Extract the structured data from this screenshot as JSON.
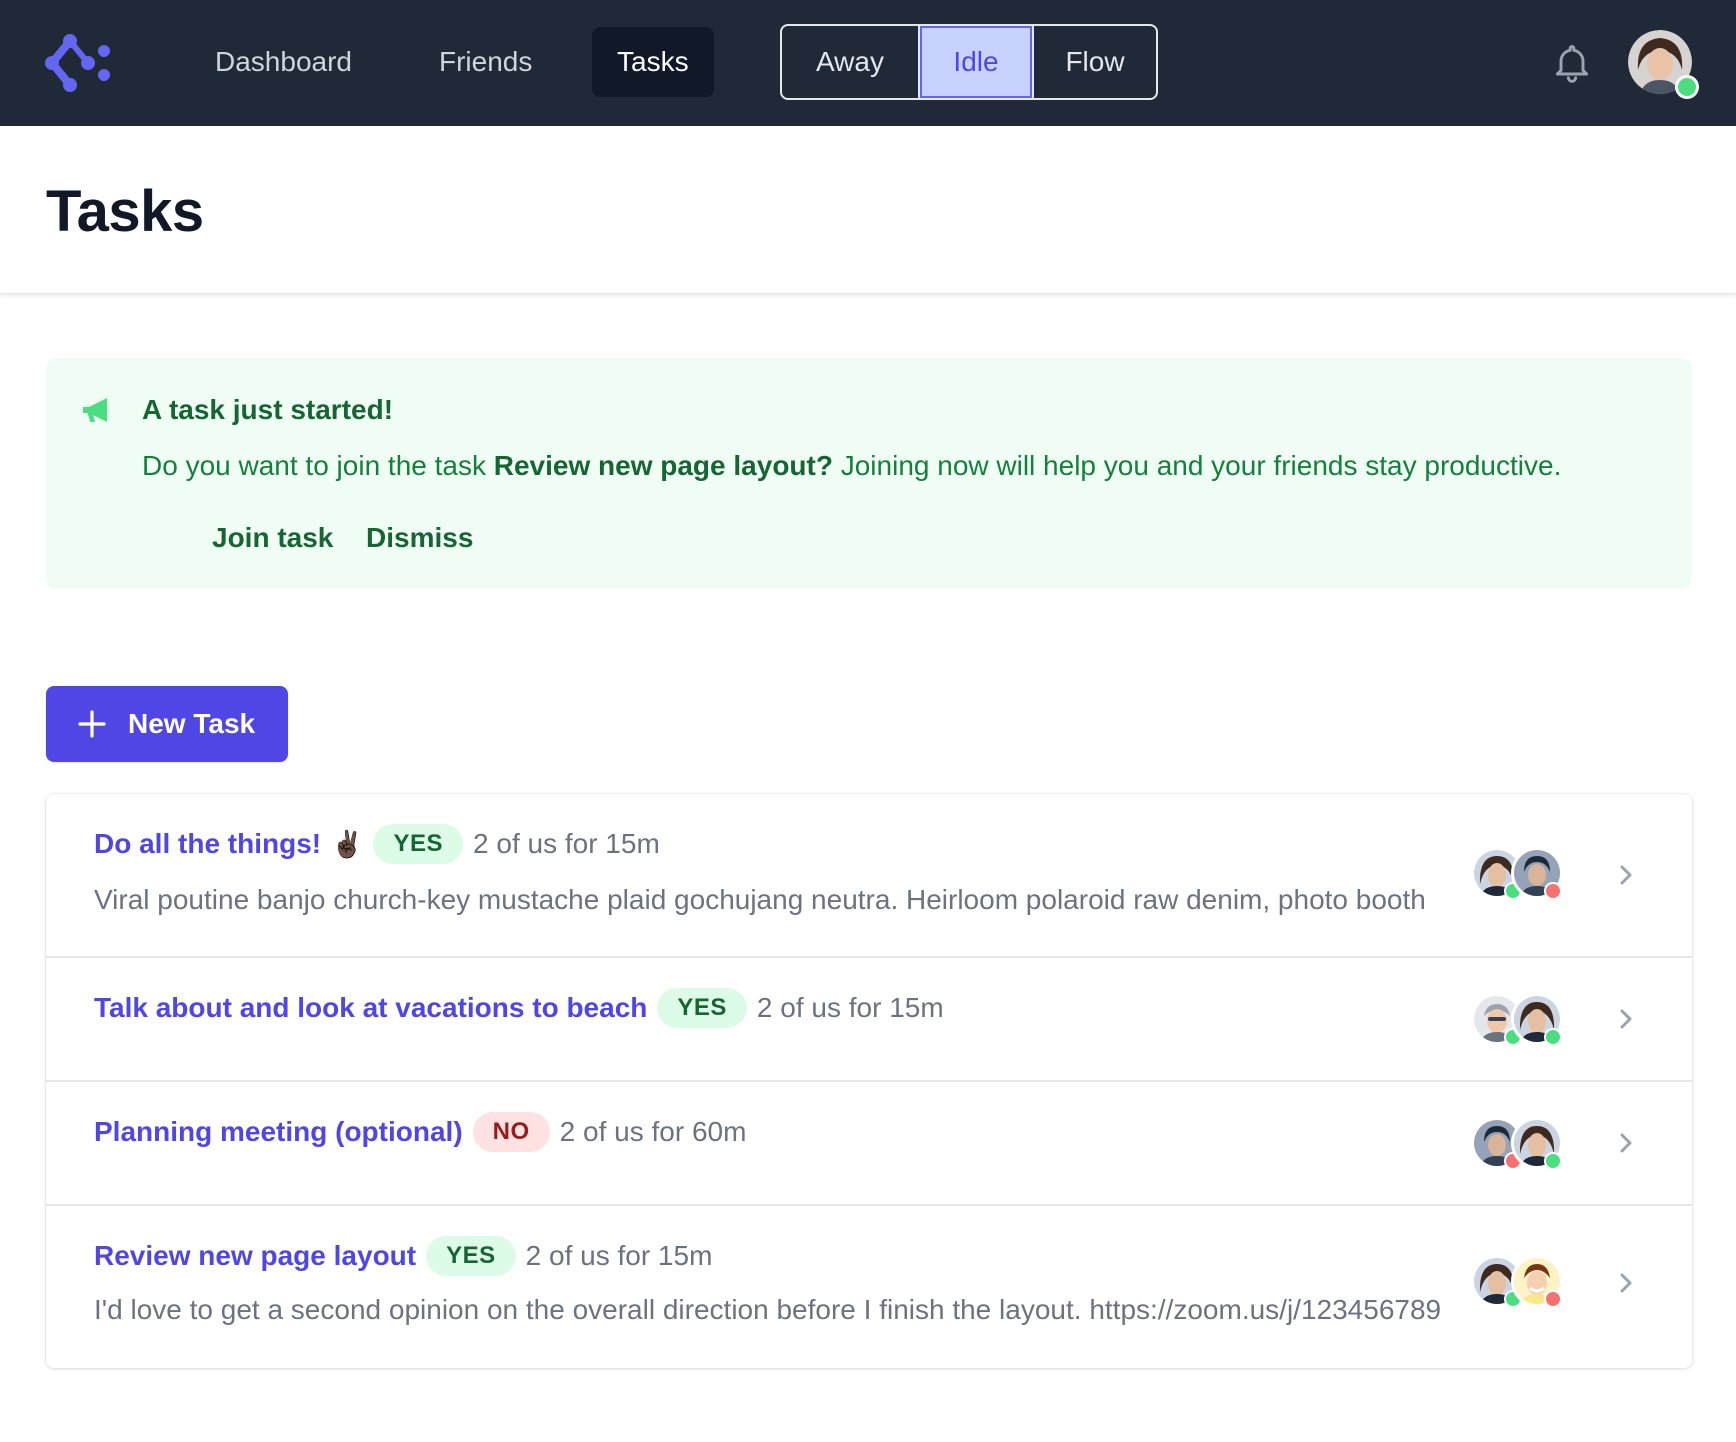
{
  "nav": {
    "links": [
      {
        "label": "Dashboard"
      },
      {
        "label": "Friends"
      },
      {
        "label": "Tasks"
      }
    ],
    "status_options": [
      {
        "label": "Away"
      },
      {
        "label": "Idle"
      },
      {
        "label": "Flow"
      }
    ],
    "selected_status": "Idle"
  },
  "page": {
    "title": "Tasks"
  },
  "alert": {
    "title": "A task just started!",
    "body_prefix": "Do you want to join the task ",
    "body_task": "Review new page layout?",
    "body_suffix": " Joining now will help you and your friends stay productive.",
    "join_label": "Join task",
    "dismiss_label": "Dismiss"
  },
  "new_task_label": "New Task",
  "tasks": [
    {
      "title": "Do all the things!",
      "emoji": "✌🏿",
      "badge": "YES",
      "meta": "2 of us for 15m",
      "description": "Viral poutine banjo church-key mustache plaid gochujang neutra. Heirloom polaroid raw denim, photo booth"
    },
    {
      "title": "Talk about and look at vacations to beach",
      "emoji": "",
      "badge": "YES",
      "meta": "2 of us for 15m",
      "description": ""
    },
    {
      "title": "Planning meeting (optional)",
      "emoji": "",
      "badge": "NO",
      "meta": "2 of us for 60m",
      "description": ""
    },
    {
      "title": "Review new page layout",
      "emoji": "",
      "badge": "YES",
      "meta": "2 of us for 15m",
      "description": "I'd love to get a second opinion on the overall direction before I finish the layout. https://zoom.us/j/123456789"
    }
  ],
  "colors": {
    "nav_bg": "#1f2937",
    "accent": "#4f46e5",
    "alert_bg": "#f0fdf4",
    "online": "#4ade80",
    "busy": "#f87171"
  }
}
